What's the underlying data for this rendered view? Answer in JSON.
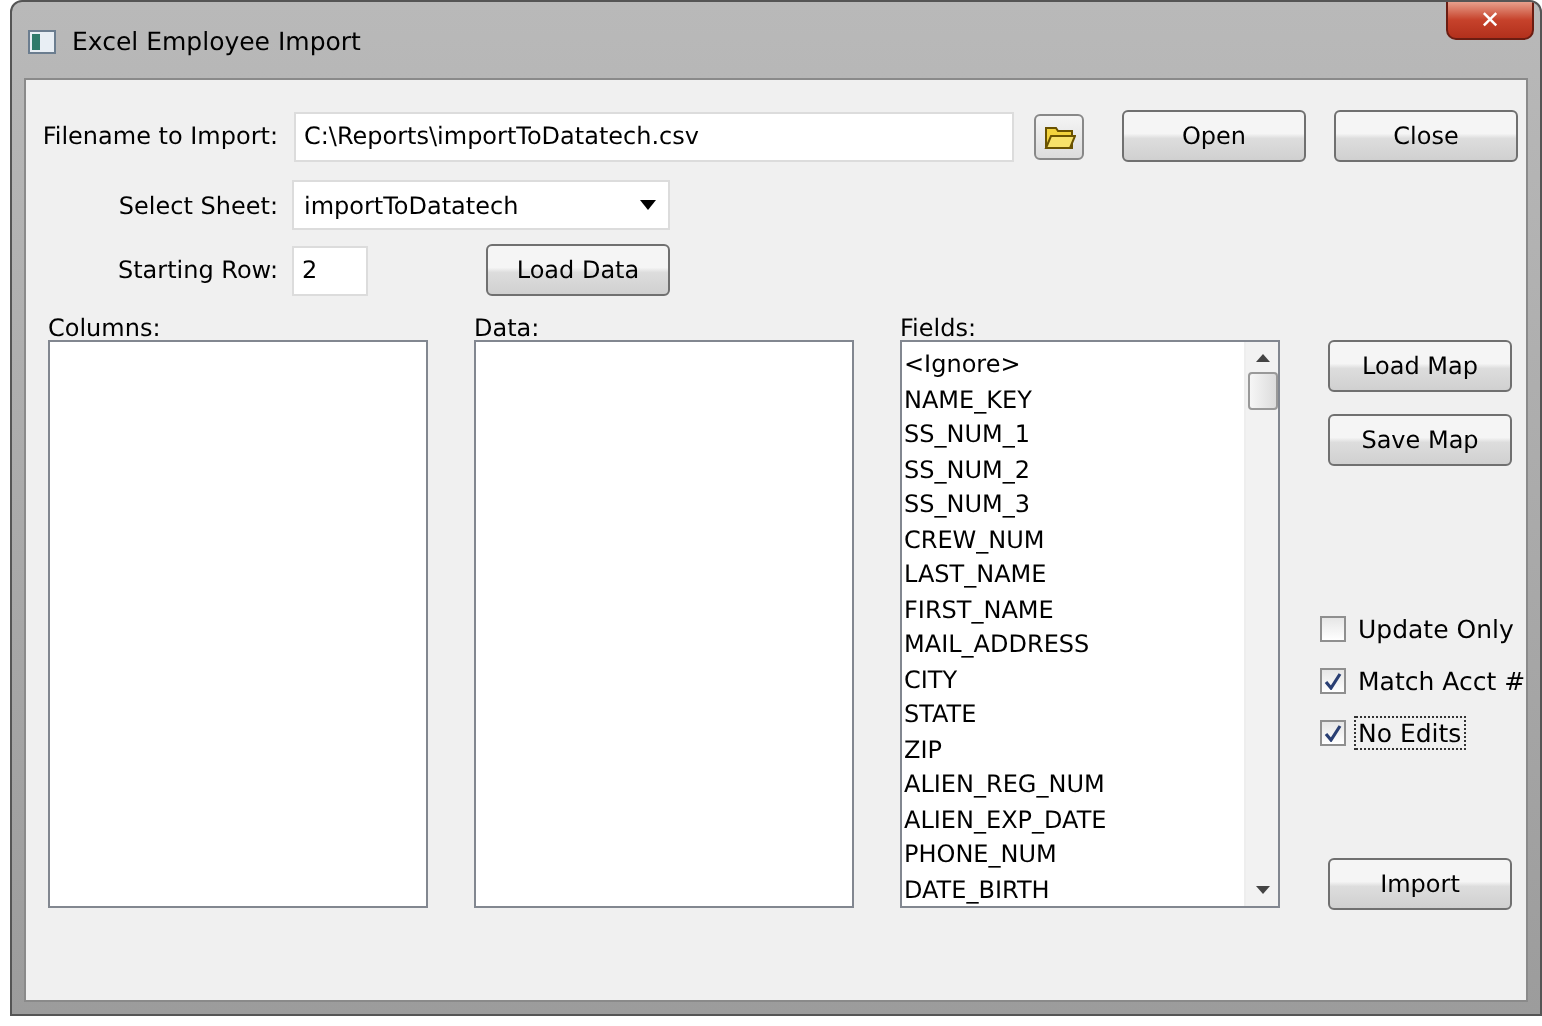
{
  "window": {
    "title": "Excel Employee Import",
    "close": "✕"
  },
  "filename": {
    "label": "Filename to Import:",
    "value": "C:\\Reports\\importToDatatech.csv"
  },
  "top_buttons": [
    "Open",
    "Close"
  ],
  "sheet": {
    "label": "Select Sheet:",
    "value": "importToDatatech"
  },
  "starting_row": {
    "label": "Starting Row:",
    "value": "2"
  },
  "load_data": "Load Data",
  "columns": {
    "label": "Columns:"
  },
  "data": {
    "label": "Data:"
  },
  "fields": {
    "label": "Fields:",
    "items": [
      "<Ignore>",
      "NAME_KEY",
      "SS_NUM_1",
      "SS_NUM_2",
      "SS_NUM_3",
      "CREW_NUM",
      "LAST_NAME",
      "FIRST_NAME",
      "MAIL_ADDRESS",
      "CITY",
      "STATE",
      "ZIP",
      "ALIEN_REG_NUM",
      "ALIEN_EXP_DATE",
      "PHONE_NUM",
      "DATE_BIRTH"
    ]
  },
  "map_buttons": [
    "Load Map",
    "Save Map"
  ],
  "options": [
    {
      "label": "Update Only",
      "checked": false,
      "focused": false
    },
    {
      "label": "Match Acct #",
      "checked": true,
      "focused": false
    },
    {
      "label": "No Edits",
      "checked": true,
      "focused": true
    }
  ],
  "import": "Import"
}
